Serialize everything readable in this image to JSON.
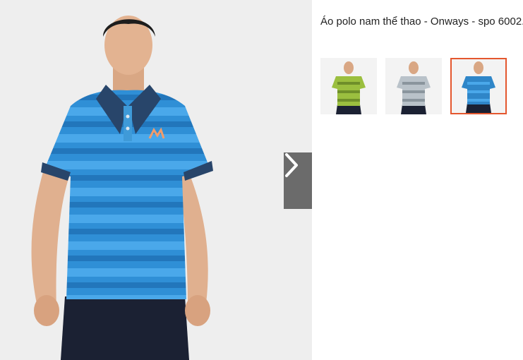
{
  "product": {
    "title": "Áo polo nam thể thao - Onways - spo 6002."
  },
  "viewer": {
    "next_icon": "chevron-right-icon"
  },
  "thumbnails": [
    {
      "label": "green-striped-polo",
      "color": "#9bbf3f",
      "selected": false
    },
    {
      "label": "grey-striped-polo",
      "color": "#b9c2c9",
      "selected": false
    },
    {
      "label": "blue-striped-polo",
      "color": "#2f86c8",
      "selected": true
    }
  ],
  "colors": {
    "accent": "#e4572e",
    "shirt_blue": "#2f8fd6",
    "collar_navy": "#28456a"
  }
}
